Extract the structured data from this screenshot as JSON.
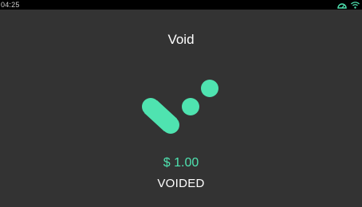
{
  "status_bar": {
    "time": "04:25",
    "icons": [
      "speedometer-icon",
      "wifi-icon"
    ]
  },
  "screen": {
    "title": "Void",
    "logo_icon": "void-logo-icon",
    "amount": "$ 1.00",
    "status": "VOIDED"
  },
  "colors": {
    "background": "#333333",
    "status_bar": "#000000",
    "accent": "#4fe3b0",
    "text": "#ffffff"
  }
}
